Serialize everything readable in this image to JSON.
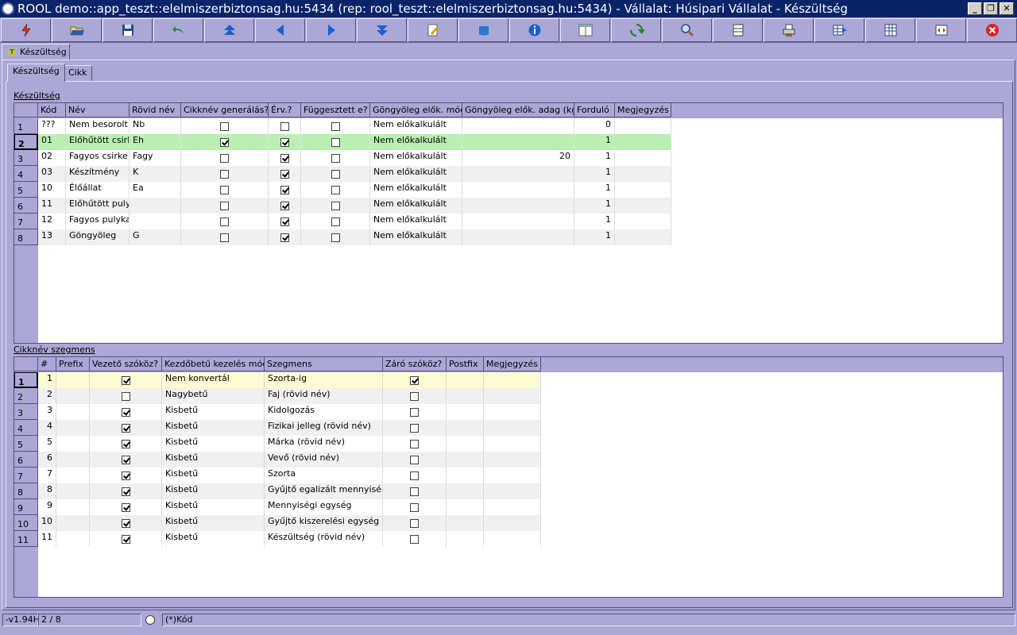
{
  "window": {
    "title": "ROOL demo::app_teszt::elelmiszerbiztonsag.hu:5434 (rep: rool_teszt::elelmiszerbiztonsag.hu:5434) - Vállalat: Húsipari Vállalat - Készültség",
    "minimize_label": "_",
    "restore_label": "❐",
    "close_label": "✕"
  },
  "toolbar": {
    "buttons": [
      {
        "icon": "lightning-icon",
        "color": "#c0392b"
      },
      {
        "icon": "open-folder-icon",
        "color": "#2a5db0"
      },
      {
        "icon": "save-icon",
        "color": "#2a4a8a"
      },
      {
        "icon": "undo-icon",
        "color": "#1e8a2e"
      },
      {
        "icon": "first-record-icon",
        "color": "#1a5fd0"
      },
      {
        "icon": "previous-record-icon",
        "color": "#1a5fd0"
      },
      {
        "icon": "next-record-icon",
        "color": "#1a5fd0"
      },
      {
        "icon": "last-record-icon",
        "color": "#1a5fd0"
      },
      {
        "icon": "edit-icon",
        "color": "#d8a000"
      },
      {
        "icon": "database-icon",
        "color": "#2a7ad0"
      },
      {
        "icon": "info-icon",
        "color": "#1a5fd0"
      },
      {
        "icon": "form-view-icon",
        "color": "#606060"
      },
      {
        "icon": "refresh-icon",
        "color": "#1e8a2e"
      },
      {
        "icon": "search-icon",
        "color": "#2a4a8a"
      },
      {
        "icon": "split-view-icon",
        "color": "#404040"
      },
      {
        "icon": "print-icon",
        "color": "#8a6a2a"
      },
      {
        "icon": "export-grid-icon",
        "color": "#2a4a8a"
      },
      {
        "icon": "grid-settings-icon",
        "color": "#2a4a8a"
      },
      {
        "icon": "fit-screen-icon",
        "color": "#c0392b"
      },
      {
        "icon": "exit-icon",
        "color": "#e02020"
      }
    ]
  },
  "outer_tab": {
    "label": "Készültség",
    "icon": "form-icon"
  },
  "inner_tabs": [
    {
      "label": "Készültség",
      "active": true
    },
    {
      "label": "Cikk",
      "active": false
    }
  ],
  "grid1": {
    "label": "Készültség",
    "columns": [
      "Kód",
      "Név",
      "Rövid név",
      "Cikknév generálás?",
      "Érv.?",
      "Függesztett e?",
      "Göngyöleg elők. mód",
      "Göngyöleg elők. adag (kg)",
      "Forduló",
      "Megjegyzés"
    ],
    "rows": [
      {
        "n": "1",
        "kod": "???",
        "nev": "Nem besorolt",
        "rovid": "Nb",
        "gen": false,
        "erv": false,
        "fugg": false,
        "mod": "Nem előkalkulált",
        "adag": "",
        "fordulo": "0",
        "megj": ""
      },
      {
        "n": "2",
        "kod": "01",
        "nev": "Előhűtött csirke",
        "rovid": "Eh",
        "gen": true,
        "erv": true,
        "fugg": false,
        "mod": "Nem előkalkulált",
        "adag": "",
        "fordulo": "1",
        "megj": ""
      },
      {
        "n": "3",
        "kod": "02",
        "nev": "Fagyos csirke",
        "rovid": "Fagy",
        "gen": false,
        "erv": true,
        "fugg": false,
        "mod": "Nem előkalkulált",
        "adag": "20",
        "fordulo": "1",
        "megj": ""
      },
      {
        "n": "4",
        "kod": "03",
        "nev": "Készítmény",
        "rovid": "K",
        "gen": false,
        "erv": true,
        "fugg": false,
        "mod": "Nem előkalkulált",
        "adag": "",
        "fordulo": "1",
        "megj": ""
      },
      {
        "n": "5",
        "kod": "10",
        "nev": "Élőállat",
        "rovid": "Ea",
        "gen": false,
        "erv": true,
        "fugg": false,
        "mod": "Nem előkalkulált",
        "adag": "",
        "fordulo": "1",
        "megj": ""
      },
      {
        "n": "6",
        "kod": "11",
        "nev": "Előhűtött pulyka",
        "rovid": "",
        "gen": false,
        "erv": true,
        "fugg": false,
        "mod": "Nem előkalkulált",
        "adag": "",
        "fordulo": "1",
        "megj": ""
      },
      {
        "n": "7",
        "kod": "12",
        "nev": "Fagyos pulyka",
        "rovid": "",
        "gen": false,
        "erv": true,
        "fugg": false,
        "mod": "Nem előkalkulált",
        "adag": "",
        "fordulo": "1",
        "megj": ""
      },
      {
        "n": "8",
        "kod": "13",
        "nev": "Göngyöleg",
        "rovid": "G",
        "gen": false,
        "erv": true,
        "fugg": false,
        "mod": "Nem előkalkulált",
        "adag": "",
        "fordulo": "1",
        "megj": ""
      }
    ]
  },
  "grid2": {
    "label": "Cikknév szegmens",
    "columns": [
      "#",
      "Prefix",
      "Vezető szóköz?",
      "Kezdőbetű kezelés mód",
      "Szegmens",
      "Záró szóköz?",
      "Postfix",
      "Megjegyzés"
    ],
    "rows": [
      {
        "n": "1",
        "num": "1",
        "prefix": "",
        "vez": true,
        "mod": "Nem konvertál",
        "szeg": "Szorta-ig",
        "zaro": true,
        "post": "",
        "megj": ""
      },
      {
        "n": "2",
        "num": "2",
        "prefix": "",
        "vez": false,
        "mod": "Nagybetű",
        "szeg": "Faj (rövid név)",
        "zaro": false,
        "post": "",
        "megj": ""
      },
      {
        "n": "3",
        "num": "3",
        "prefix": "",
        "vez": true,
        "mod": "Kisbetű",
        "szeg": "Kidolgozás",
        "zaro": false,
        "post": "",
        "megj": ""
      },
      {
        "n": "4",
        "num": "4",
        "prefix": "",
        "vez": true,
        "mod": "Kisbetű",
        "szeg": "Fizikai jelleg (rövid név)",
        "zaro": false,
        "post": "",
        "megj": ""
      },
      {
        "n": "5",
        "num": "5",
        "prefix": "",
        "vez": true,
        "mod": "Kisbetű",
        "szeg": "Márka (rövid név)",
        "zaro": false,
        "post": "",
        "megj": ""
      },
      {
        "n": "6",
        "num": "6",
        "prefix": "",
        "vez": true,
        "mod": "Kisbetű",
        "szeg": "Vevő (rövid név)",
        "zaro": false,
        "post": "",
        "megj": ""
      },
      {
        "n": "7",
        "num": "7",
        "prefix": "",
        "vez": true,
        "mod": "Kisbetű",
        "szeg": "Szorta",
        "zaro": false,
        "post": "",
        "megj": ""
      },
      {
        "n": "8",
        "num": "8",
        "prefix": "",
        "vez": true,
        "mod": "Kisbetű",
        "szeg": "Gyűjtő egalizált mennyiség",
        "zaro": false,
        "post": "",
        "megj": ""
      },
      {
        "n": "9",
        "num": "9",
        "prefix": "",
        "vez": true,
        "mod": "Kisbetű",
        "szeg": "Mennyiségi egység",
        "zaro": false,
        "post": "",
        "megj": ""
      },
      {
        "n": "10",
        "num": "10",
        "prefix": "",
        "vez": true,
        "mod": "Kisbetű",
        "szeg": "Gyűjtő kiszerelési egység kód",
        "zaro": false,
        "post": "",
        "megj": ""
      },
      {
        "n": "11",
        "num": "11",
        "prefix": "",
        "vez": true,
        "mod": "Kisbetű",
        "szeg": "Készültség (rövid név)",
        "zaro": false,
        "post": "",
        "megj": ""
      }
    ]
  },
  "statusbar": {
    "version": "-v1.94H",
    "position": "2 / 8",
    "sort": "(*)Kód"
  }
}
